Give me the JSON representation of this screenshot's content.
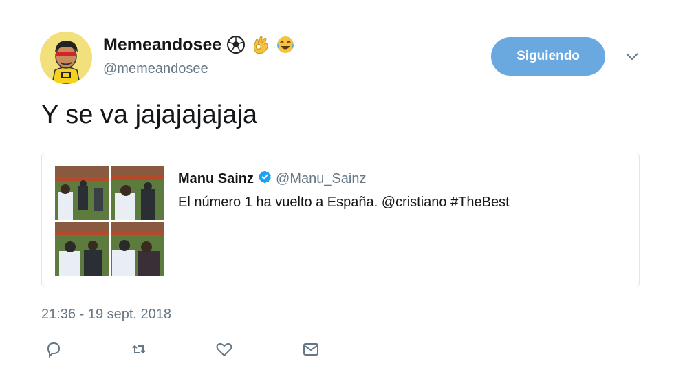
{
  "author": {
    "display_name": "Memeandosee",
    "handle": "@memeandosee",
    "emojis": [
      "soccer-ball-emoji",
      "ok-hand-emoji",
      "tears-of-joy-emoji"
    ]
  },
  "follow_button": {
    "label": "Siguiendo",
    "color": "#6aa9e0"
  },
  "tweet": {
    "text": "Y se va jajajajajaja",
    "timestamp": "21:36 - 19 sept. 2018"
  },
  "quoted_tweet": {
    "display_name": "Manu Sainz",
    "verified": true,
    "handle": "@Manu_Sainz",
    "text": "El número 1 ha vuelto a España. @cristiano #TheBest",
    "media_count": 4
  },
  "actions": [
    "reply-icon",
    "retweet-icon",
    "like-icon",
    "message-icon"
  ],
  "colors": {
    "text": "#14171a",
    "secondary": "#657786",
    "verified": "#1da1f2",
    "border": "#e1e8ed"
  }
}
